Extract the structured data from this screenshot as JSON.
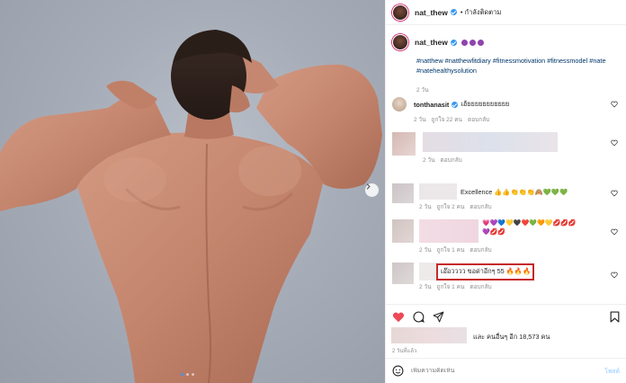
{
  "post": {
    "username": "nat_thew",
    "follow_label": "• กำลังติดตาม",
    "caption_hashtags": "#natthew #natthewfitdiary #fitnessmotivation #fitnessmodel #nate #natehealthysolution",
    "caption_time": "2 วัน",
    "carousel": {
      "total_slides": 3,
      "current_slide": 1
    }
  },
  "comments": [
    {
      "username": "tonthanasit",
      "text": "เฮ้ยยยยยยยยยยย",
      "time": "2 วัน",
      "likes": "ถูกใจ 22 คน",
      "reply": "ตอบกลับ"
    },
    {
      "time": "2 วัน",
      "reply": "ตอบกลับ"
    },
    {
      "text": "Excellence 👍👍👏👏👏🙈💚💚💚",
      "time": "2 วัน",
      "likes": "ถูกใจ 2 คน",
      "reply": "ตอบกลับ"
    },
    {
      "text": "💗💜💙💛🖤❤️💚🧡💛💋💋💋💜💋💋",
      "time": "2 วัน",
      "likes": "ถูกใจ 1 คน",
      "reply": "ตอบกลับ"
    },
    {
      "text": "เอ๊อวววว ขอด่าอีกๆ 55 🔥🔥🔥",
      "time": "2 วัน",
      "likes": "ถูกใจ 1 คน",
      "reply": "ตอบกลับ"
    }
  ],
  "likes_text": "และ คนอื่นๆ อีก 18,573 คน",
  "post_age": "2 วันที่แล้ว",
  "comment_box": {
    "placeholder": "เพิ่มความคิดเห็น",
    "post_label": "โพสต์"
  },
  "colors": {
    "accent": "#3897f0",
    "highlight_border": "#c62828",
    "like_red": "#ed4956"
  },
  "icons": {
    "like": "heart-icon",
    "comment": "comment-bubble-icon",
    "share": "paper-plane-icon",
    "save": "bookmark-icon",
    "emoji": "smiley-icon",
    "next": "chevron-right-icon"
  }
}
